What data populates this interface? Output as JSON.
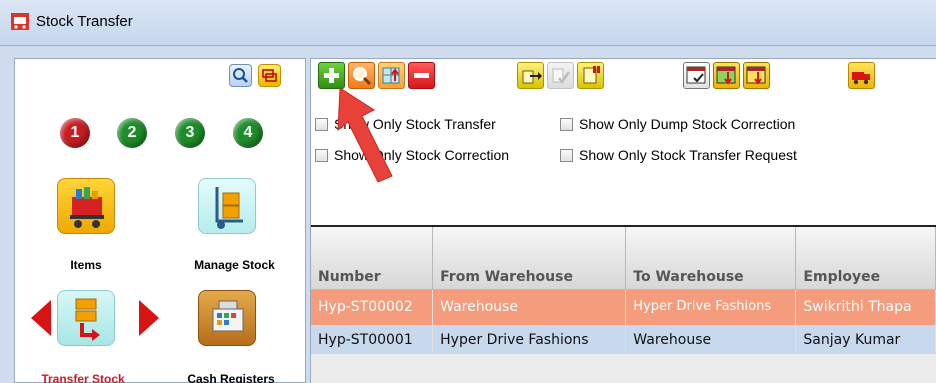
{
  "window": {
    "title": "Stock Transfer"
  },
  "sidebar": {
    "steps": [
      "1",
      "2",
      "3",
      "4"
    ],
    "tiles": [
      {
        "label": "Items"
      },
      {
        "label": "Manage Stock"
      },
      {
        "label": "Transfer Stock"
      },
      {
        "label": "Cash Registers"
      }
    ]
  },
  "filters": [
    {
      "label": "Show Only Stock Transfer",
      "checked": false
    },
    {
      "label": "Show Only Dump Stock Correction",
      "checked": false
    },
    {
      "label": "Show Only Stock Correction",
      "checked": false
    },
    {
      "label": "Show Only Stock Transfer Request",
      "checked": false
    }
  ],
  "table": {
    "columns": [
      "Number",
      "From Warehouse",
      "To Warehouse",
      "Employee"
    ],
    "rows": [
      {
        "number": "Hyp-ST00002",
        "from": "Warehouse",
        "to": "Hyper Drive Fashions",
        "employee": "Swikrithi Thapa",
        "selected": true
      },
      {
        "number": "Hyp-ST00001",
        "from": "Hyper Drive Fashions",
        "to": "Warehouse",
        "employee": "Sanjay Kumar",
        "selected": false
      }
    ]
  },
  "colors": {
    "selected_row": "#f59c7d",
    "normal_row": "#c8d9ed",
    "active_tile_label": "#c81d22",
    "annotation_arrow": "#e8413a"
  }
}
